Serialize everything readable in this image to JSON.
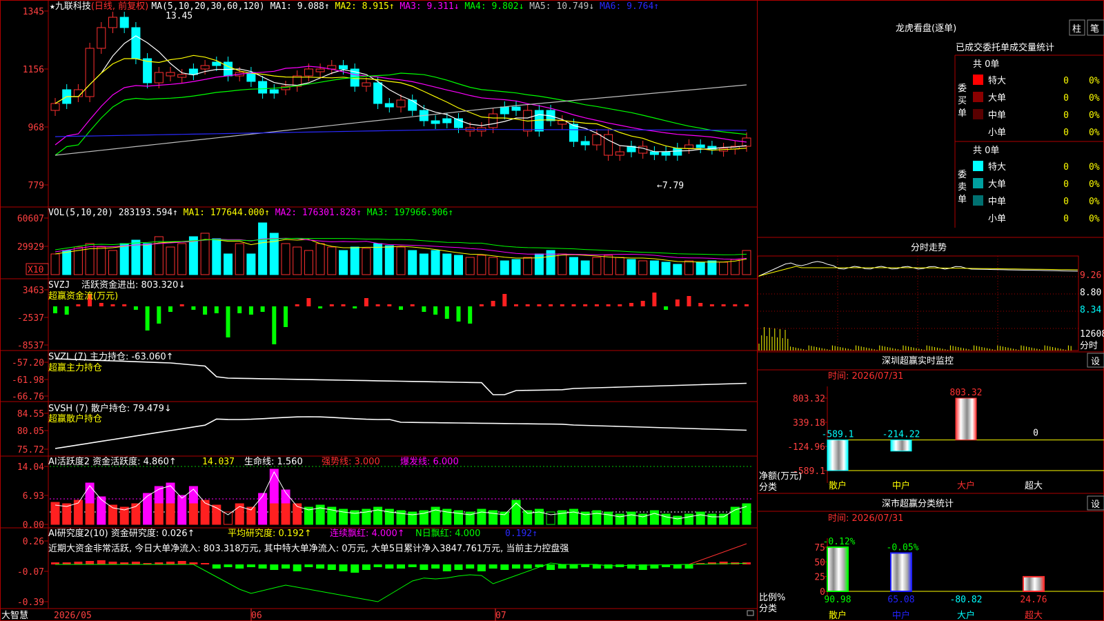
{
  "colors": {
    "up": "#ff3030",
    "down": "#00ffff",
    "grid": "#b00000",
    "axis_text": "#ff4040",
    "white": "#ffffff",
    "yellow": "#ffff00",
    "magenta": "#ff00ff",
    "green": "#00ff00",
    "blue": "#2a2aff",
    "gray": "#c0c0c0",
    "teal": "#008b8b"
  },
  "stock": {
    "star": "★",
    "name": "九联科技",
    "period": "(日线, 前复权)"
  },
  "ma_header": {
    "label": "MA(5,10,20,30,60,120)",
    "items": [
      {
        "text": "MA1: 9.088↑",
        "color": "#ffffff"
      },
      {
        "text": "MA2: 8.915↑",
        "color": "#ffff00"
      },
      {
        "text": "MA3: 9.311↓",
        "color": "#ff00ff"
      },
      {
        "text": "MA4: 9.802↓",
        "color": "#00ff00"
      },
      {
        "text": "MA5: 10.749↓",
        "color": "#c0c0c0"
      },
      {
        "text": "MA6: 9.764↑",
        "color": "#2a2aff"
      }
    ]
  },
  "price_axis": {
    "ticks": [
      "1345",
      "1156",
      "968",
      "779"
    ]
  },
  "price_annotations": {
    "high": "13.45",
    "low": "←7.79"
  },
  "vol_header": {
    "label": "VOL(5,10,20)",
    "items": [
      {
        "text": "283193.594↑",
        "color": "#ffffff"
      },
      {
        "text": "MA1: 177644.000↑",
        "color": "#ffff00"
      },
      {
        "text": "MA2: 176301.828↑",
        "color": "#ff00ff"
      },
      {
        "text": "MA3: 197966.906↑",
        "color": "#00ff00"
      }
    ],
    "ticks": [
      "60607",
      "29929"
    ],
    "unit": "X10"
  },
  "svzj": {
    "line1_a": "SVZJ",
    "line1_b": "活跃资金进出: 803.320↓",
    "line2": "超赢资金流(万元)",
    "ticks": [
      "3463",
      "-2537",
      "-8537"
    ]
  },
  "svzl": {
    "line1": "SVZL (7) 主力持仓: -63.060↑",
    "line2": "超赢主力持仓",
    "ticks": [
      "-57.20",
      "-61.98",
      "-66.76"
    ]
  },
  "svsh": {
    "line1": "SVSH (7) 散户持仓: 79.479↓",
    "line2": "超赢散户持仓",
    "ticks": [
      "84.55",
      "80.05",
      "75.72"
    ]
  },
  "ai_active": {
    "label": "AI活跃度2 资金活跃度: 4.860↑",
    "v2": "14.037",
    "life": "生命线: 1.560",
    "strong": "强势线: 3.000",
    "burst": "爆发线: 6.000",
    "ticks": [
      "14.04",
      "6.93",
      "0.00"
    ]
  },
  "ai_research": {
    "label": "AI研究度2(10) 资金研究度: 0.026↑",
    "avg": "平均研究度: 0.192↑",
    "lianxu": "连续飘红: 4.000↑",
    "nday": "N日飘红: 4.000",
    "v": "0.192↑",
    "message": "近期大资金非常活跃, 今日大单净流入: 803.318万元, 其中特大单净流入: 0万元, 大单5日累计净入3847.761万元, 当前主力控盘强",
    "ticks": [
      "0.26",
      "-0.07",
      "-0.39"
    ]
  },
  "bottom_axis": {
    "brand": "大智慧",
    "dates": [
      "2026/05",
      "06",
      "07"
    ]
  },
  "longhu": {
    "title": "龙虎看盘(逐单)",
    "btn1": "柱",
    "btn2": "笔",
    "header": "已成交委托单成交量统计",
    "buy": {
      "side": "委买单",
      "total": "共 0单",
      "rows": [
        {
          "label": "特大",
          "val": "0",
          "pct": "0%",
          "color": "#ff0000"
        },
        {
          "label": "大单",
          "val": "0",
          "pct": "0%",
          "color": "#8b0000"
        },
        {
          "label": "中单",
          "val": "0",
          "pct": "0%",
          "color": "#5a0000"
        },
        {
          "label": "小单",
          "val": "0",
          "pct": "0%",
          "color": ""
        }
      ]
    },
    "sell": {
      "side": "委卖单",
      "total": "共 0单",
      "rows": [
        {
          "label": "特大",
          "val": "0",
          "pct": "0%",
          "color": "#00ffff"
        },
        {
          "label": "大单",
          "val": "0",
          "pct": "0%",
          "color": "#00a0a0"
        },
        {
          "label": "中单",
          "val": "0",
          "pct": "0%",
          "color": "#007070"
        },
        {
          "label": "小单",
          "val": "0",
          "pct": "0%",
          "color": ""
        }
      ]
    }
  },
  "intraday": {
    "title": "分时走势",
    "ticks": [
      "9.26",
      "8.80",
      "8.34",
      "12608"
    ],
    "unit": "分时"
  },
  "sz_monitor": {
    "title": "深圳超赢实时监控",
    "setting": "设",
    "time": "时间: 2026/07/31",
    "ylabel": "净额(万元)",
    "xlabel": "分类",
    "ticks": [
      "803.32",
      "339.18",
      "-124.96",
      "-589.1"
    ]
  },
  "sz_stats": {
    "title": "深市超赢分类统计",
    "setting": "设",
    "time": "时间: 2026/07/31",
    "ylabel": "比例%",
    "xlabel": "分类",
    "ticks": [
      "75",
      "50",
      "25",
      "0"
    ]
  },
  "chart_data": [
    {
      "type": "bar",
      "title": "深圳超赢实时监控",
      "ylabel": "净额(万元)",
      "xlabel": "分类",
      "categories": [
        "散户",
        "中户",
        "大户",
        "超大"
      ],
      "values": [
        -589.1,
        -214.22,
        803.32,
        0
      ],
      "ylim": [
        -589.1,
        803.32
      ]
    },
    {
      "type": "bar",
      "title": "深市超赢分类统计",
      "ylabel": "比例%",
      "xlabel": "分类",
      "categories": [
        "散户",
        "中户",
        "大户",
        "超大"
      ],
      "series": [
        {
          "values": [
            90.98,
            65.08,
            -80.82,
            24.76
          ]
        },
        {
          "values": [
            -0.12,
            -0.05,
            null,
            null
          ]
        }
      ],
      "ylim": [
        0,
        75
      ]
    },
    {
      "type": "line",
      "title": "九联科技(日线, 前复权)",
      "ylim": [
        7.79,
        13.45
      ],
      "high": 13.45,
      "low": 7.79
    }
  ]
}
